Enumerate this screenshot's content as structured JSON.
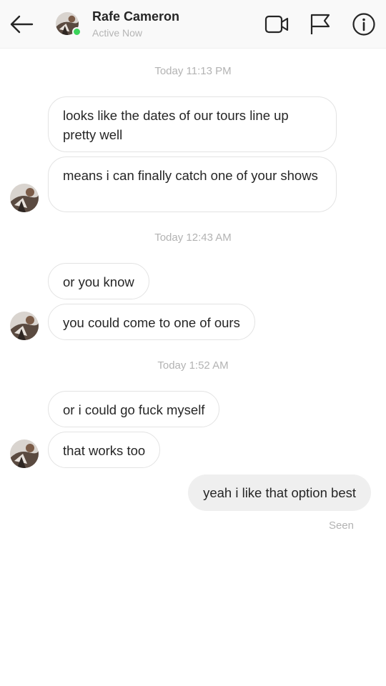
{
  "header": {
    "back_icon": "arrow-left-icon",
    "contact_name": "Rafe Cameron",
    "status": "Active Now",
    "status_color": "#3bd45a",
    "video_icon": "video-camera-icon",
    "flag_icon": "flag-icon",
    "info_icon": "info-icon"
  },
  "messages": {
    "timestamps": [
      "Today 11:13 PM",
      "Today 12:43 AM",
      "Today 1:52 AM"
    ],
    "received": [
      "looks like the dates of our tours line up pretty well",
      "means i can finally catch one of your shows",
      "or you know",
      "you could come to one of ours",
      "or i could go fuck myself",
      "that works too"
    ],
    "sent": [
      "yeah i like that option best"
    ],
    "seen_label": "Seen"
  },
  "colors": {
    "header_bg": "#f9f9f9",
    "sent_bubble": "#efefef",
    "received_border": "#e3e3e3",
    "muted_text": "#b3b3b3"
  }
}
